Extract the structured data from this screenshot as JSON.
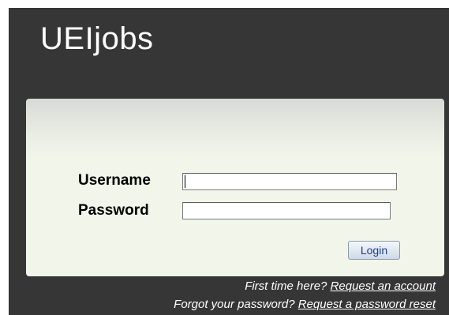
{
  "app": {
    "title": "UEIjobs"
  },
  "login_form": {
    "username_label": "Username",
    "username_value": "",
    "password_label": "Password",
    "password_value": "",
    "submit_label": "Login"
  },
  "help": {
    "first_time_text": "First time here?",
    "request_account_link": "Request an account",
    "forgot_password_text": "Forgot your password?",
    "reset_password_link": "Request a password reset"
  },
  "colors": {
    "frame_background": "#363636",
    "panel_background": "#f2f6ea",
    "text_on_dark": "#ffffff",
    "button_text": "#1a3f8f"
  }
}
